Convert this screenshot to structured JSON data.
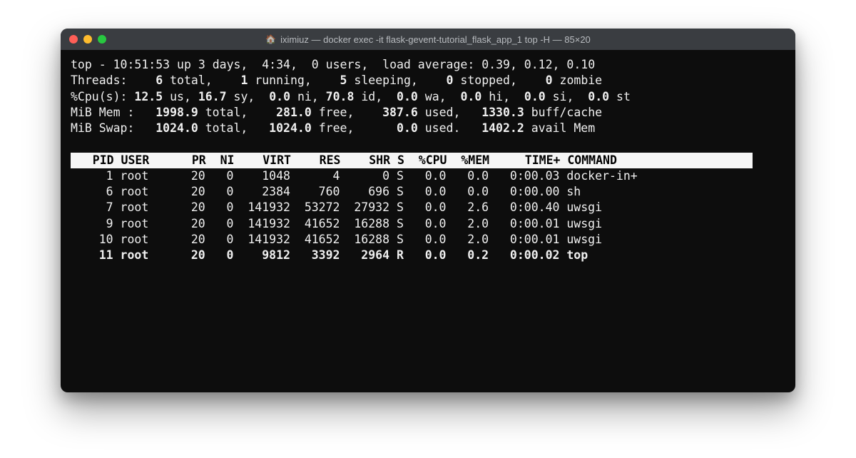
{
  "window": {
    "title": "iximiuz — docker exec -it flask-gevent-tutorial_flask_app_1 top -H — 85×20"
  },
  "top": {
    "line1_pre": "top - ",
    "time": "10:51:53",
    "uptime_pre": " up 3 days,  4:34,  ",
    "users": "0 users",
    "load_pre": ",  load average: 0.39, 0.12, 0.10",
    "threads_label": "Threads:",
    "threads_total": "    6 ",
    "threads_total_lbl": "total,",
    "threads_running": "    1 ",
    "threads_running_lbl": "running,",
    "threads_sleeping": "    5 ",
    "threads_sleeping_lbl": "sleeping,",
    "threads_stopped": "    0 ",
    "threads_stopped_lbl": "stopped,",
    "threads_zombie": "    0 ",
    "threads_zombie_lbl": "zombie",
    "cpu_label": "%Cpu(s):",
    "cpu_us": " 12.5 ",
    "cpu_us_lbl": "us,",
    "cpu_sy": " 16.7 ",
    "cpu_sy_lbl": "sy,",
    "cpu_ni": "  0.0 ",
    "cpu_ni_lbl": "ni,",
    "cpu_id": " 70.8 ",
    "cpu_id_lbl": "id,",
    "cpu_wa": "  0.0 ",
    "cpu_wa_lbl": "wa,",
    "cpu_hi": "  0.0 ",
    "cpu_hi_lbl": "hi,",
    "cpu_si": "  0.0 ",
    "cpu_si_lbl": "si,",
    "cpu_st": "  0.0 ",
    "cpu_st_lbl": "st",
    "mem_label": "MiB Mem :",
    "mem_total": "   1998.9 ",
    "mem_total_lbl": "total,",
    "mem_free": "    281.0 ",
    "mem_free_lbl": "free,",
    "mem_used": "    387.6 ",
    "mem_used_lbl": "used,",
    "mem_buff": "   1330.3 ",
    "mem_buff_lbl": "buff/cache",
    "swap_label": "MiB Swap:",
    "swap_total": "   1024.0 ",
    "swap_total_lbl": "total,",
    "swap_free": "   1024.0 ",
    "swap_free_lbl": "free,",
    "swap_used": "      0.0 ",
    "swap_used_lbl": "used.",
    "swap_avail": "   1402.2 ",
    "swap_avail_lbl": "avail Mem"
  },
  "columns_header": "   PID USER      PR  NI    VIRT    RES    SHR S  %CPU  %MEM     TIME+ COMMAND                   ",
  "processes": [
    {
      "row": "     1 root      20   0    1048      4      0 S   0.0   0.0   0:00.03 docker-in+",
      "bold": false
    },
    {
      "row": "     6 root      20   0    2384    760    696 S   0.0   0.0   0:00.00 sh",
      "bold": false
    },
    {
      "row": "     7 root      20   0  141932  53272  27932 S   0.0   2.6   0:00.40 uwsgi",
      "bold": false
    },
    {
      "row": "     9 root      20   0  141932  41652  16288 S   0.0   2.0   0:00.01 uwsgi",
      "bold": false
    },
    {
      "row": "    10 root      20   0  141932  41652  16288 S   0.0   2.0   0:00.01 uwsgi",
      "bold": false
    },
    {
      "row": "    11 root      20   0    9812   3392   2964 R   0.0   0.2   0:00.02 top",
      "bold": true
    }
  ]
}
